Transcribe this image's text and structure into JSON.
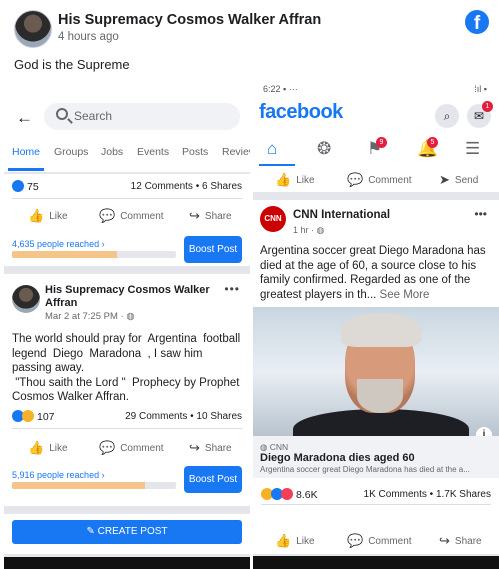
{
  "outer_post": {
    "author": "His Supremacy Cosmos Walker Affran",
    "time": "4 hours ago",
    "caption": "God is the Supreme",
    "fb_glyph": "f"
  },
  "left": {
    "search_placeholder": "Search",
    "tabs": [
      "Home",
      "Groups",
      "Jobs",
      "Events",
      "Posts",
      "Review"
    ],
    "post1": {
      "reaction_count": "75",
      "stats": "12 Comments • 6 Shares",
      "reach": "4,635 people reached ›",
      "reach_pct": 0.64,
      "boost": "Boost Post"
    },
    "post2": {
      "author": "His Supremacy  Cosmos Walker Affran",
      "time": "Mar 2 at 7:25 PM · ",
      "text": "The world should pray for  Argentina  football legend  Diego  Maradona  , I saw him passing away.\n \"Thou saith the Lord \"  Prophecy by Prophet  Cosmos Walker Affran.",
      "reaction_count": "107",
      "stats": "29 Comments • 10 Shares",
      "reach": "5,916 people reached ›",
      "reach_pct": 0.81,
      "boost": "Boost Post"
    },
    "actions": {
      "like": "Like",
      "comment": "Comment",
      "share": "Share"
    },
    "create_post": "CREATE POST"
  },
  "right": {
    "status_time": "6:22",
    "status_glyphs": "▪ ···",
    "status_right": "⁞ıl ▪",
    "logo": "facebook",
    "messenger_badge": "1",
    "flag_badge": "9",
    "bell_badge": "5",
    "actions_top": {
      "like": "Like",
      "comment": "Comment",
      "send": "Send"
    },
    "post": {
      "source_logo": "CNN",
      "author": "CNN International",
      "time": "1 hr · ",
      "text": "Argentina soccer great Diego Maradona has died at the age of 60, a source close to his family confirmed. Regarded as one of the greatest players in th...",
      "see_more": "See More",
      "link_source": "CNN",
      "link_title": "Diego Maradona dies aged 60",
      "link_desc": "Argentina soccer great Diego Maradona has died at the a...",
      "reaction_count": "8.6K",
      "stats": "1K Comments • 1.7K Shares"
    },
    "actions": {
      "like": "Like",
      "comment": "Comment",
      "share": "Share"
    }
  },
  "icons": [
    "back-arrow-icon",
    "search-icon",
    "like-icon",
    "comment-icon",
    "share-icon",
    "send-icon",
    "home-icon",
    "groups-icon",
    "flag-icon",
    "bell-icon",
    "menu-icon",
    "messenger-icon",
    "more-icon",
    "globe-icon",
    "create-post-icon",
    "info-icon"
  ],
  "colors": {
    "brand": "#1877f2",
    "bg": "#e4e6eb",
    "text": "#1c1e21",
    "muted": "#65676b",
    "reach_fill": "#f5c48a"
  }
}
